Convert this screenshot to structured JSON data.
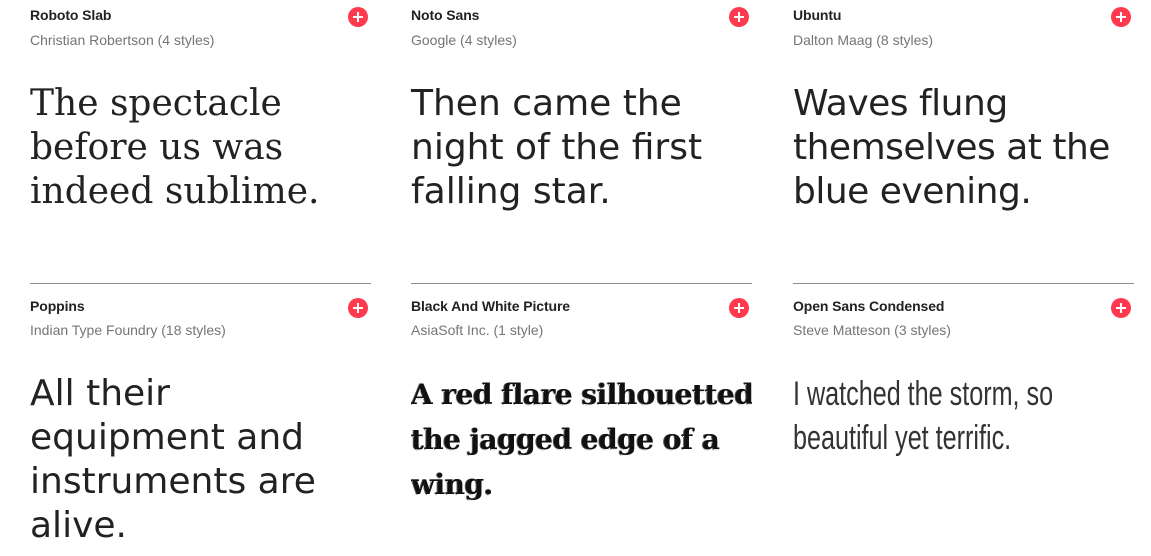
{
  "fonts": [
    {
      "name": "Roboto Slab",
      "designer": "Christian Robertson (4 styles)",
      "sample": "The spectacle before us was indeed sublime.",
      "add_icon": "plus-circle-icon"
    },
    {
      "name": "Noto Sans",
      "designer": "Google (4 styles)",
      "sample": "Then came the night of the first falling star.",
      "add_icon": "plus-circle-icon"
    },
    {
      "name": "Ubuntu",
      "designer": "Dalton Maag (8 styles)",
      "sample": "Waves flung themselves at the blue evening.",
      "add_icon": "plus-circle-icon"
    },
    {
      "name": "Poppins",
      "designer": "Indian Type Foundry (18 styles)",
      "sample": "All their equipment and instruments are alive.",
      "add_icon": "plus-circle-icon"
    },
    {
      "name": "Black And White Picture",
      "designer": "AsiaSoft Inc. (1 style)",
      "sample": "A red flare silhouetted the jagged edge of a wing.",
      "add_icon": "plus-circle-icon"
    },
    {
      "name": "Open Sans Condensed",
      "designer": "Steve Matteson (3 styles)",
      "sample": "I watched the storm, so beautiful yet terrific.",
      "add_icon": "plus-circle-icon"
    }
  ],
  "colors": {
    "accent": "#ff3a4e",
    "text": "#222222",
    "muted": "#757575",
    "divider": "#8f8f8f"
  }
}
